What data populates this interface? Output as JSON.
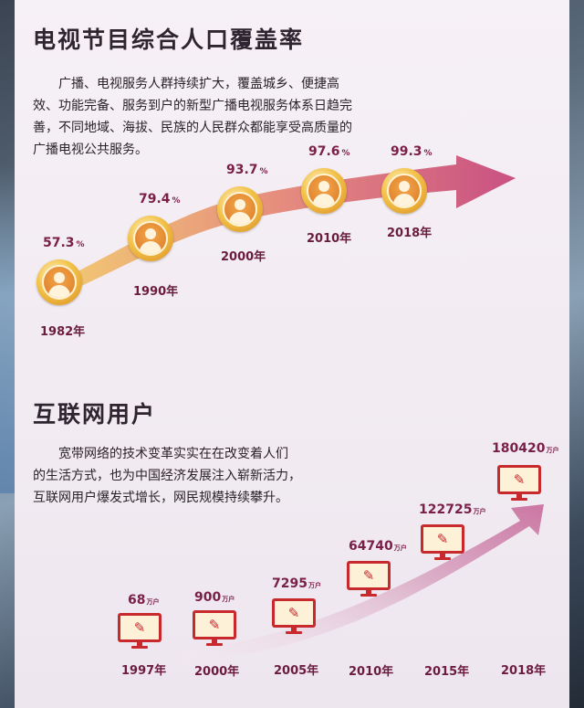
{
  "section1": {
    "title": "电视节目综合人口覆盖率",
    "paragraph_lines": [
      "　　广播、电视服务人群持续扩大，覆盖城乡、便捷高",
      "效、功能完备、服务到户的新型广播电视服务体系日趋完",
      "善，不同地域、海拔、民族的人民群众都能享受高质量的",
      "广播电视公共服务。"
    ],
    "unit": "%",
    "year_suffix": "年",
    "icon": "person-icon"
  },
  "section2": {
    "title": "互联网用户",
    "paragraph_lines": [
      "　　宽带网络的技术变革实实在在改变着人们",
      "的生活方式，也为中国经济发展注入崭新活力，",
      "互联网用户爆发式增长，网民规模持续攀升。"
    ],
    "unit": "万户",
    "year_suffix": "年",
    "icon": "monitor-icon"
  },
  "colors": {
    "accent": "#7a1f48",
    "arrow_start": "#f0c05a",
    "arrow_end": "#c2356e",
    "monitor": "#c8292c"
  },
  "chart_data": [
    {
      "type": "line",
      "title": "电视节目综合人口覆盖率",
      "x": [
        "1982",
        "1990",
        "2000",
        "2010",
        "2018"
      ],
      "series": [
        {
          "values": [
            57.3,
            79.4,
            93.7,
            97.6,
            99.3
          ]
        }
      ],
      "value_labels": [
        "57.3",
        "79.4",
        "93.7",
        "97.6",
        "99.3"
      ],
      "unit": "%",
      "x_labels": [
        "1982年",
        "1990年",
        "2000年",
        "2010年",
        "2018年"
      ]
    },
    {
      "type": "line",
      "title": "互联网用户",
      "x": [
        "1997",
        "2000",
        "2005",
        "2010",
        "2015",
        "2018"
      ],
      "series": [
        {
          "values": [
            68,
            900,
            7295,
            64740,
            122725,
            180420
          ]
        }
      ],
      "value_labels": [
        "68",
        "900",
        "7295",
        "64740",
        "122725",
        "180420"
      ],
      "unit": "万户",
      "x_labels": [
        "1997年",
        "2000年",
        "2005年",
        "2010年",
        "2015年",
        "2018年"
      ]
    }
  ]
}
